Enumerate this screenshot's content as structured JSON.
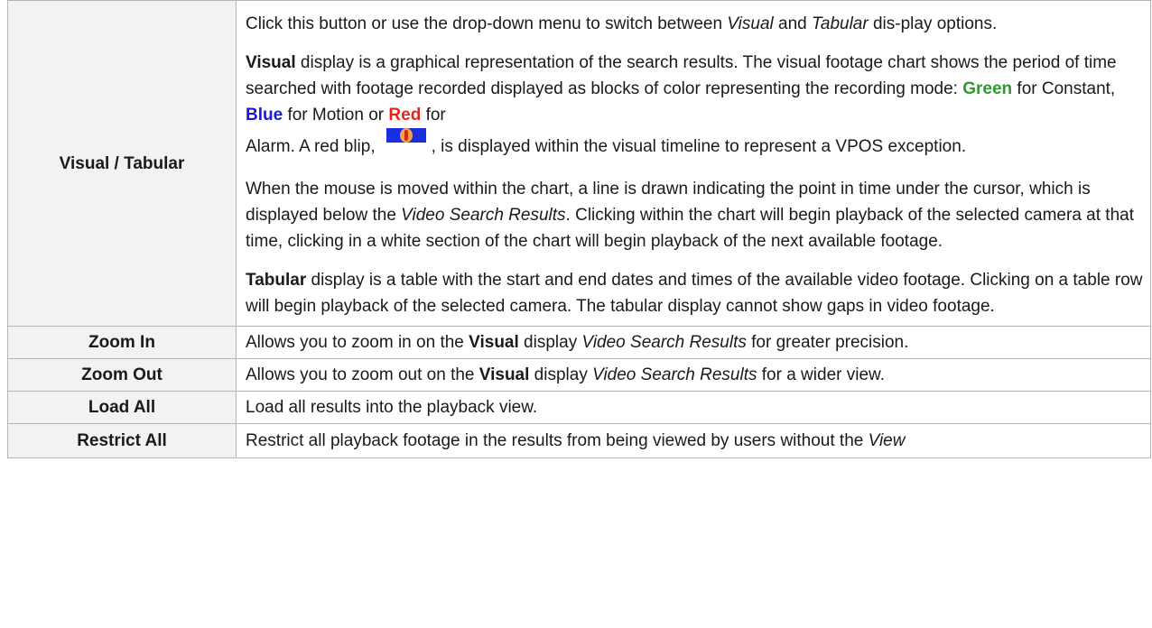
{
  "rows": [
    {
      "term": "Visual / Tabular",
      "paragraphs": {
        "p1": {
          "t1": "Click this button or use the drop-down menu to switch between ",
          "visual_em": "Visual",
          "t2": " and ",
          "tabular_em": "Tabular",
          "t3": " dis-play options."
        },
        "p2": {
          "visual_kw": "Visual",
          "t1": " display is a graphical representation of the search results. The visual footage chart shows the period of time searched with footage recorded displayed as blocks of color representing the recording mode: ",
          "green": "Green",
          "t2": " for Constant, ",
          "blue": "Blue",
          "t3": " for Motion or ",
          "red": "Red",
          "t4": " for",
          "t5": "Alarm. A red blip,",
          "t6": ", is displayed within the visual timeline to represent a VPOS exception."
        },
        "p3": {
          "t1": "When the mouse is moved within the chart, a line is drawn indicating the point in time under the cursor, which is displayed below the ",
          "em1": "Video Search Results",
          "t2": ". Clicking within the chart will begin playback of the selected camera at that time, clicking in a white section of the chart will begin playback of the next available footage."
        },
        "p4": {
          "tabular_kw": "Tabular",
          "t1": " display is a table with the start and end dates and times of the available video footage. Clicking on a table row will begin playback of the selected camera. The tabular display cannot show gaps in video footage."
        }
      }
    },
    {
      "term": "Zoom In",
      "t1": "Allows you to zoom in on the ",
      "kw": "Visual",
      "t2": " display ",
      "em": "Video Search Results",
      "t3": " for greater precision."
    },
    {
      "term": "Zoom Out",
      "t1": "Allows you to zoom out on the ",
      "kw": "Visual",
      "t2": " display ",
      "em": "Video Search Results",
      "t3": " for a wider view."
    },
    {
      "term": "Load All",
      "t1": "Load all results into the playback view."
    },
    {
      "term": "Restrict All",
      "t1": "Restrict all playback footage in the results from being viewed by users without the ",
      "em": "View"
    }
  ],
  "icons": {
    "vpos_blip": "vpos-exception-blip-icon"
  },
  "colors": {
    "green": "#2e9a2e",
    "blue": "#1a1ad6",
    "red": "#e3261c",
    "term_background": "#f2f2f2",
    "border": "#b5b5b5"
  }
}
